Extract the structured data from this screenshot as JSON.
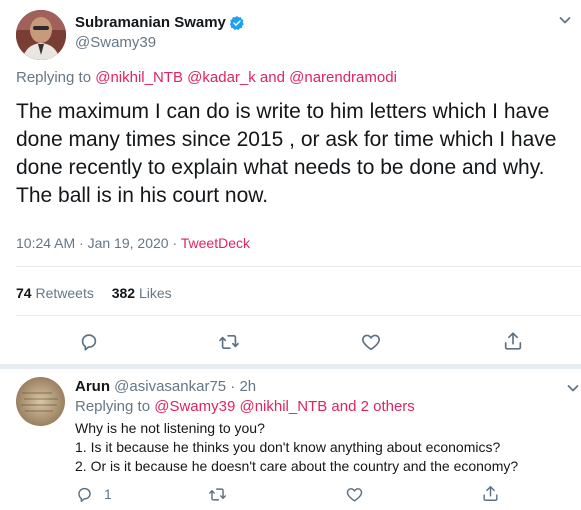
{
  "tweet": {
    "author_name": "Subramanian Swamy",
    "author_handle": "@Swamy39",
    "verified": true,
    "replying_prefix": "Replying to",
    "replying_to": [
      "@nikhil_NTB",
      "@kadar_k",
      "and",
      "@narendramodi"
    ],
    "text": "The maximum I can do is write to him letters which I have done many times since 2015 , or ask for time which I have done recently to explain what needs to be done and why. The ball is in his court now.",
    "time": "10:24 AM · Jan 19, 2020 · ",
    "source": "TweetDeck",
    "retweet_count": "74",
    "retweet_label": "Retweets",
    "like_count": "382",
    "like_label": "Likes"
  },
  "reply": {
    "author_name": "Arun",
    "author_handle": "@asivasankar75 · 2h",
    "replying_prefix": "Replying to",
    "replying_to": "@Swamy39 @nikhil_NTB and 2 others",
    "line1": "Why is he not listening to you?",
    "line2": "1. Is it because he thinks you don't know anything about economics?",
    "line3": "2. Or is it because he doesn't care about the country and the economy?",
    "reply_count": "1"
  },
  "icons": {
    "menu": "chevron-down-icon",
    "reply": "reply-icon",
    "retweet": "retweet-icon",
    "like": "heart-icon",
    "share": "share-icon",
    "verified": "verified-badge-icon"
  },
  "colors": {
    "accent": "#e0245e",
    "verified": "#1da1f2",
    "muted": "#657786"
  }
}
